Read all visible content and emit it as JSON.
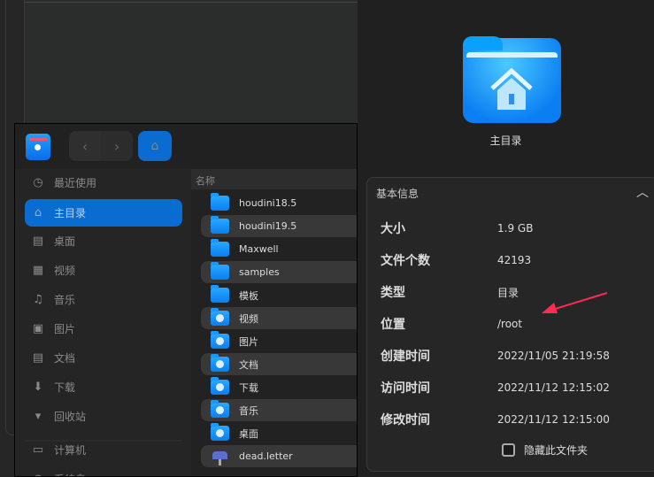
{
  "toolbar": {
    "back": "‹",
    "forward": "›",
    "home": "⌂"
  },
  "sidebar": {
    "items": [
      {
        "label": "最近使用",
        "icon": "clock-icon",
        "glyph": "◷"
      },
      {
        "label": "主目录",
        "icon": "home-icon",
        "glyph": "⌂",
        "active": true
      },
      {
        "label": "桌面",
        "icon": "desktop-icon",
        "glyph": "▤"
      },
      {
        "label": "视频",
        "icon": "video-icon",
        "glyph": "▦"
      },
      {
        "label": "音乐",
        "icon": "music-icon",
        "glyph": "♫"
      },
      {
        "label": "图片",
        "icon": "picture-icon",
        "glyph": "▣"
      },
      {
        "label": "文档",
        "icon": "document-icon",
        "glyph": "▤"
      },
      {
        "label": "下载",
        "icon": "download-icon",
        "glyph": "⬇"
      },
      {
        "label": "回收站",
        "icon": "trash-icon",
        "glyph": "▾"
      },
      {
        "label": "计算机",
        "icon": "computer-icon",
        "glyph": "▭"
      },
      {
        "label": "系统盘",
        "icon": "disk-icon",
        "glyph": "◍"
      }
    ]
  },
  "list": {
    "header": "名称",
    "rows": [
      {
        "name": "houdini18.5",
        "type": "folder"
      },
      {
        "name": "houdini19.5",
        "type": "folder"
      },
      {
        "name": "Maxwell",
        "type": "folder"
      },
      {
        "name": "samples",
        "type": "folder"
      },
      {
        "name": "模板",
        "type": "folder"
      },
      {
        "name": "视频",
        "type": "special"
      },
      {
        "name": "图片",
        "type": "special"
      },
      {
        "name": "文档",
        "type": "special"
      },
      {
        "name": "下载",
        "type": "special"
      },
      {
        "name": "音乐",
        "type": "special"
      },
      {
        "name": "桌面",
        "type": "special"
      },
      {
        "name": "dead.letter",
        "type": "mail"
      }
    ]
  },
  "details": {
    "title": "主目录",
    "section": "基本信息",
    "rows": [
      {
        "key": "大小",
        "value": "1.9 GB"
      },
      {
        "key": "文件个数",
        "value": "42193"
      },
      {
        "key": "类型",
        "value": "目录"
      },
      {
        "key": "位置",
        "value": "/root"
      },
      {
        "key": "创建时间",
        "value": "2022/11/05 21:19:58"
      },
      {
        "key": "访问时间",
        "value": "2022/11/12 12:15:02"
      },
      {
        "key": "修改时间",
        "value": "2022/11/12 12:15:00"
      }
    ],
    "hide_label": "隐藏此文件夹",
    "hide_checked": false
  },
  "colors": {
    "accent": "#0a6bd0",
    "arrow": "#ff2a55"
  }
}
